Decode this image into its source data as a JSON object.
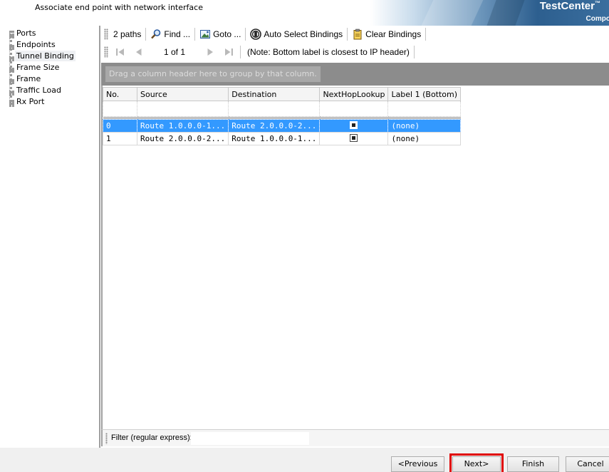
{
  "header": {
    "subtitle": "Associate end point with network interface",
    "brand_name": "TestCenter",
    "brand_tm": "™",
    "brand_sub": "Compo"
  },
  "nav": {
    "items": [
      {
        "label": "Ports"
      },
      {
        "label": "Endpoints"
      },
      {
        "label": "Tunnel Binding",
        "selected": true
      },
      {
        "label": "Frame Size"
      },
      {
        "label": "Frame"
      },
      {
        "label": "Traffic Load"
      },
      {
        "label": "Rx Port"
      }
    ]
  },
  "toolbar": {
    "paths_label": "2 paths",
    "find_label": "Find ...",
    "goto_label": "Goto ...",
    "auto_select_label": "Auto Select Bindings",
    "clear_label": "Clear Bindings",
    "page_text": "1 of 1",
    "note": "(Note: Bottom label is closest to IP header)"
  },
  "grid": {
    "group_hint": "Drag a column header here to group by that column.",
    "columns": [
      "No.",
      "Source",
      "Destination",
      "NextHopLookup",
      "Label 1 (Bottom)"
    ],
    "rows": [
      {
        "no": "0",
        "source": "Route 1.0.0.0-1...",
        "destination": "Route 2.0.0.0-2...",
        "nexthop": true,
        "label": "(none)",
        "selected": true
      },
      {
        "no": "1",
        "source": "Route 2.0.0.0-2...",
        "destination": "Route 1.0.0.0-1...",
        "nexthop": true,
        "label": "(none)",
        "selected": false
      }
    ]
  },
  "filter": {
    "label": "Filter (regular express):",
    "value": ""
  },
  "footer": {
    "previous": "<Previous",
    "next": "Next>",
    "finish": "Finish",
    "cancel": "Cancel"
  },
  "colors": {
    "selection": "#3399ff",
    "highlight": "#e00000"
  }
}
